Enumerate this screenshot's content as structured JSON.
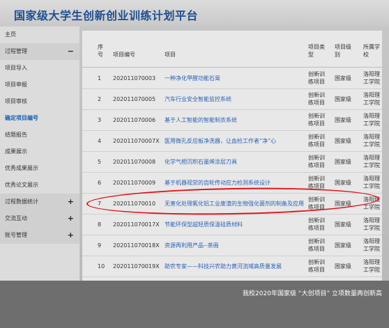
{
  "app": {
    "title": "国家级大学生创新创业训练计划平台"
  },
  "sidebar": {
    "items": [
      {
        "label": "主页",
        "toggle": ""
      },
      {
        "label": "过程管理",
        "toggle": "−"
      },
      {
        "label": "项目导入",
        "toggle": ""
      },
      {
        "label": "项目申报",
        "toggle": ""
      },
      {
        "label": "项目审核",
        "toggle": ""
      },
      {
        "label": "确定项目编号",
        "toggle": ""
      },
      {
        "label": "结题报告",
        "toggle": ""
      },
      {
        "label": "成果展示",
        "toggle": ""
      },
      {
        "label": "优秀成果展示",
        "toggle": ""
      },
      {
        "label": "优秀论文展示",
        "toggle": ""
      },
      {
        "label": "过程数据统计",
        "toggle": "+"
      },
      {
        "label": "交流互动",
        "toggle": "+"
      },
      {
        "label": "账号管理",
        "toggle": "+"
      }
    ]
  },
  "table": {
    "headers": {
      "index": "序号",
      "code": "项目编号",
      "name": "项目",
      "type": "项目类型",
      "level": "项目级别",
      "school": "所属学校"
    },
    "rows": [
      {
        "index": "1",
        "code": "202011070003",
        "name": "一种净化甲醛功能石膏",
        "type": "创新训练项目",
        "level": "国家级",
        "school": "洛阳理工学院"
      },
      {
        "index": "2",
        "code": "202011070005",
        "name": "汽车行业安全智能监控系统",
        "type": "创新训练项目",
        "level": "国家级",
        "school": "洛阳理工学院"
      },
      {
        "index": "3",
        "code": "202011070006",
        "name": "基于人工智能的智能制衣系统",
        "type": "创新训练项目",
        "level": "国家级",
        "school": "洛阳理工学院"
      },
      {
        "index": "4",
        "code": "202011070007X",
        "name": "医用微孔反应板净洗器，让血检工作者“净”心",
        "type": "创新训练项目",
        "level": "国家级",
        "school": "洛阳理工学院"
      },
      {
        "index": "5",
        "code": "202011070008",
        "name": "化学气相沉积石墨烯涂层刀具",
        "type": "创新训练项目",
        "level": "国家级",
        "school": "洛阳理工学院"
      },
      {
        "index": "6",
        "code": "202011070009",
        "name": "基于机器视觉的齿轮传动应力检测系统设计",
        "type": "创新训练项目",
        "level": "国家级",
        "school": "洛阳理工学院"
      },
      {
        "index": "7",
        "code": "202011070010",
        "name": "无害化处理氟化铝工业废渣的生物强化菌剂的制备及应用",
        "type": "创新训练项目",
        "level": "国家级",
        "school": "洛阳理工学院"
      },
      {
        "index": "8",
        "code": "202011070017X",
        "name": "节能环保型超轻质保温硅质材料",
        "type": "创新训练项目",
        "level": "国家级",
        "school": "洛阳理工学院"
      },
      {
        "index": "9",
        "code": "202011070018X",
        "name": "资源再利用产品--茶画",
        "type": "创新训练项目",
        "level": "国家级",
        "school": "洛阳理工学院"
      },
      {
        "index": "10",
        "code": "202011070019X",
        "name": "助农专家——科技兴农助力黄河流域高质量发展",
        "type": "创新训练项目",
        "level": "国家级",
        "school": "洛阳理工学院"
      }
    ]
  },
  "caption": "我校2020年国家级 “大创项目” 立项数量再创新高",
  "colors": {
    "title": "#1f4f8f",
    "link": "#2a62b5",
    "highlight_ellipse": "#e0121a",
    "caption_bg": "#6e6e6e"
  }
}
